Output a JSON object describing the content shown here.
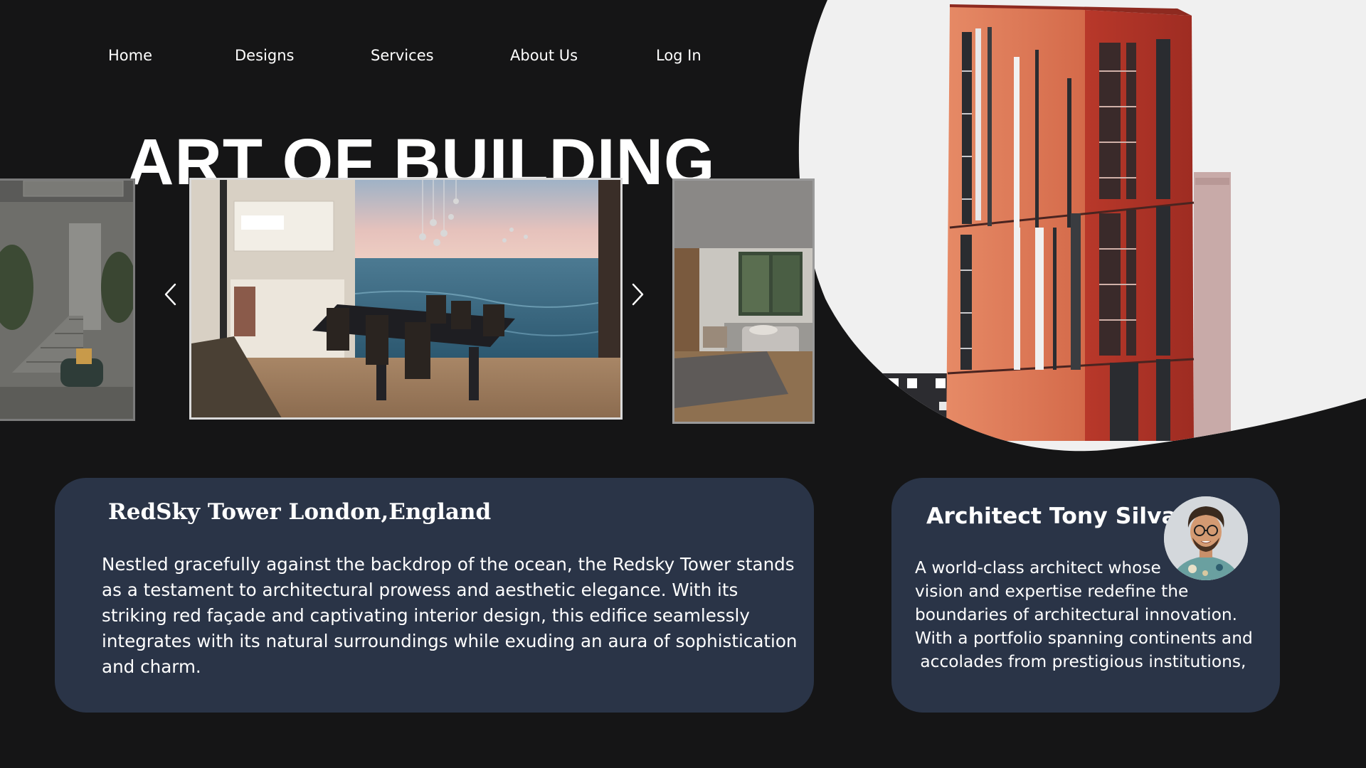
{
  "nav": {
    "items": [
      "Home",
      "Designs",
      "Services",
      "About Us",
      "Log In"
    ]
  },
  "hero": {
    "headline": "ART OF BUILDING"
  },
  "carousel": {
    "prev_icon": "chevron-left-icon",
    "next_icon": "chevron-right-icon"
  },
  "project_card": {
    "title": "RedSky Tower London,England",
    "description": "Nestled gracefully against the backdrop of the ocean, the Redsky Tower stands as a testament to architectural prowess and aesthetic elegance. With its striking red façade and captivating interior design, this edifice seamlessly integrates with its natural surroundings while exuding an aura of sophistication and charm."
  },
  "architect_card": {
    "name": "Architect Tony Silva",
    "bio_lines": [
      "A world-class architect whose",
      "vision and expertise redefine the",
      "boundaries of architectural innovation.",
      "With a portfolio spanning continents and",
      " accolades from prestigious institutions,"
    ]
  },
  "colors": {
    "background": "#151516",
    "card": "#2a3447",
    "blob": "#f0f0f0",
    "tower_red": "#c9452f",
    "tower_orange": "#e07a5a",
    "text": "#ffffff"
  }
}
